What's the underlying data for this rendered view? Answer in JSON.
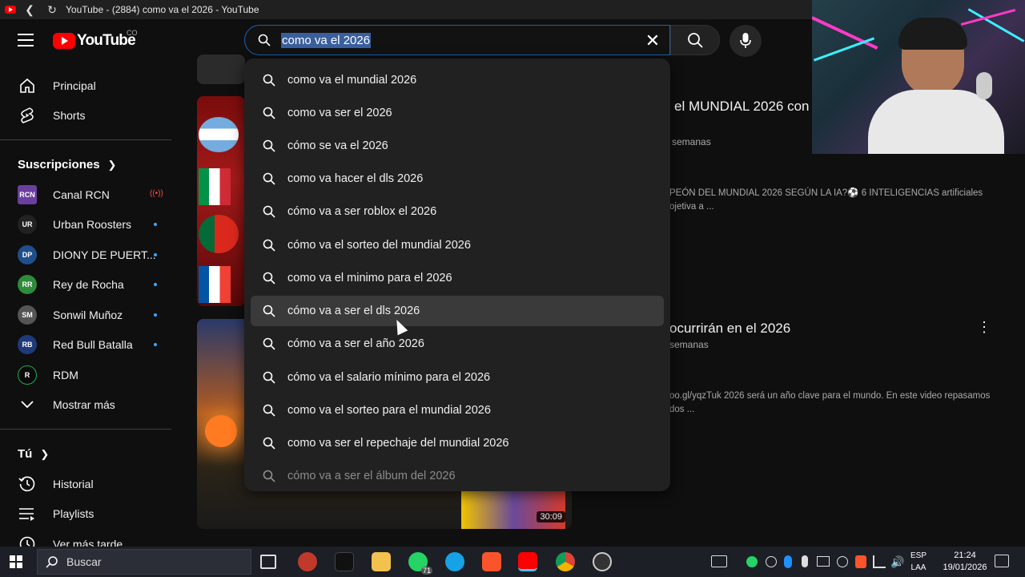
{
  "window": {
    "title": "YouTube - (2884) como va el 2026 - YouTube"
  },
  "header": {
    "logo_text": "YouTube",
    "country_code": "CO",
    "search_query": "como va el 2026"
  },
  "sidebar": {
    "main": [
      {
        "label": "Principal",
        "icon": "home-icon"
      },
      {
        "label": "Shorts",
        "icon": "shorts-icon"
      }
    ],
    "subscriptions_heading": "Suscripciones",
    "subscriptions": [
      {
        "label": "Canal RCN",
        "status": "live",
        "color": "#6b3fa0"
      },
      {
        "label": "Urban Roosters",
        "status": "new",
        "color": "#222222"
      },
      {
        "label": "DIONY DE PUERT...",
        "status": "new",
        "color": "#1e4f8c"
      },
      {
        "label": "Rey de Rocha",
        "status": "new",
        "color": "#2e8b3a"
      },
      {
        "label": "Sonwil Muñoz",
        "status": "new",
        "color": "#555555"
      },
      {
        "label": "Red Bull Batalla",
        "status": "new",
        "color": "#1f3a7a"
      },
      {
        "label": "RDM",
        "status": "",
        "color": "#0a0a0a"
      }
    ],
    "show_more": "Mostrar más",
    "you_heading": "Tú",
    "you_items": [
      {
        "label": "Historial",
        "icon": "history-icon"
      },
      {
        "label": "Playlists",
        "icon": "playlist-icon"
      },
      {
        "label": "Ver más tarde",
        "icon": "watch-later-icon"
      }
    ]
  },
  "suggestions": [
    "como va el mundial 2026",
    "como va ser el 2026",
    "cómo se va el 2026",
    "como va hacer el dls 2026",
    "cómo va a ser roblox el 2026",
    "cómo va el sorteo del mundial 2026",
    "como va el minimo para el 2026",
    "cómo va a ser el dls 2026",
    "cómo va a ser el año 2026",
    "cómo va el salario mínimo para el 2026",
    "como va el sorteo para el mundial 2026",
    "como va ser el repechaje del mundial 2026",
    "cómo va a ser el álbum del 2026"
  ],
  "results": {
    "video1": {
      "title_fragment": "el MUNDIAL 2026 con I",
      "meta_fragment": "semanas",
      "desc_line1": "PEÓN DEL MUNDIAL 2026 SEGÚN LA IA?⚽ 6 INTELIGENCIAS artificiales",
      "desc_line2": "ojetiva a ..."
    },
    "video2": {
      "title_fragment": "ocurrirán en el 2026",
      "meta_fragment": "semanas",
      "desc_line1": "oo.gl/yqzTuk 2026 será un año clave para el mundo. En este video repasamos",
      "desc_line2": "dos ...",
      "duration": "30:09"
    }
  },
  "taskbar": {
    "search_placeholder": "Buscar",
    "lang_line1": "ESP",
    "lang_line2": "LAA",
    "time": "21:24",
    "date": "19/01/2026",
    "whatsapp_badge": "71"
  }
}
